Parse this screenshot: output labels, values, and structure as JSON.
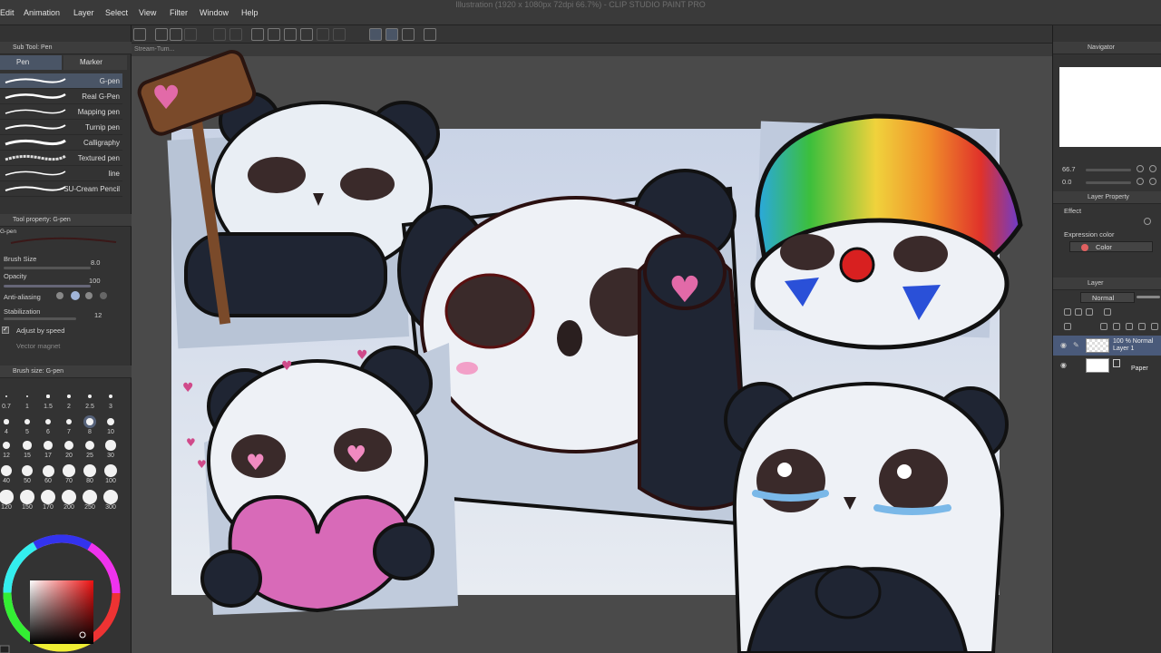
{
  "window_title": "Illustration (1920 x 1080px 72dpi 66.7%) - CLIP STUDIO PAINT PRO",
  "menu": [
    "Edit",
    "Animation",
    "Layer",
    "Select",
    "View",
    "Filter",
    "Window",
    "Help"
  ],
  "left": {
    "subtool_title": "Sub Tool: Pen",
    "tabs": [
      "Pen",
      "Marker"
    ],
    "brushes": [
      "G-pen",
      "Real G-Pen",
      "Mapping pen",
      "Turnip pen",
      "Calligraphy",
      "Textured pen",
      "line",
      "SU-Cream Pencil"
    ],
    "toolprop_title": "Tool property: G-pen",
    "toolprop_name": "G-pen",
    "props": {
      "brush_size_label": "Brush Size",
      "brush_size_value": "8.0",
      "opacity_label": "Opacity",
      "opacity_value": "100",
      "antialias_label": "Anti-aliasing",
      "stabilization_label": "Stabilization",
      "stabilization_value": "12",
      "adjust_label": "Adjust by speed",
      "vector_label": "Vector magnet"
    },
    "brushsize_title": "Brush size: G-pen",
    "size_labels": [
      "0.7",
      "1",
      "1.5",
      "2",
      "2.5",
      "3",
      "4",
      "5",
      "6",
      "7",
      "8",
      "10",
      "12",
      "15",
      "17",
      "20",
      "25",
      "30",
      "40",
      "50",
      "60",
      "70",
      "80",
      "100",
      "120",
      "150",
      "170",
      "200",
      "250",
      "300"
    ],
    "selected_size": "8",
    "selected_size_index": 10
  },
  "canvas": {
    "tab_label": "Stream-Tum...",
    "hearts": [
      "♥",
      "♥",
      "♥",
      "♥",
      "♥"
    ]
  },
  "right": {
    "navigator_title": "Navigator",
    "zoom": "66.7",
    "rotation": "0.0",
    "layerprop_title": "Layer Property",
    "effect_label": "Effect",
    "expression_label": "Expression color",
    "expression_value": "Color",
    "layer_title": "Layer",
    "blend_mode": "Normal",
    "layers": [
      {
        "meta": "100 % Normal",
        "name": "Layer 1"
      },
      {
        "meta": "",
        "name": "Paper"
      }
    ]
  },
  "colors": {
    "accent": "#56627a",
    "layer_selected": "#4a5a7a",
    "fg_color": "#cc2222"
  }
}
